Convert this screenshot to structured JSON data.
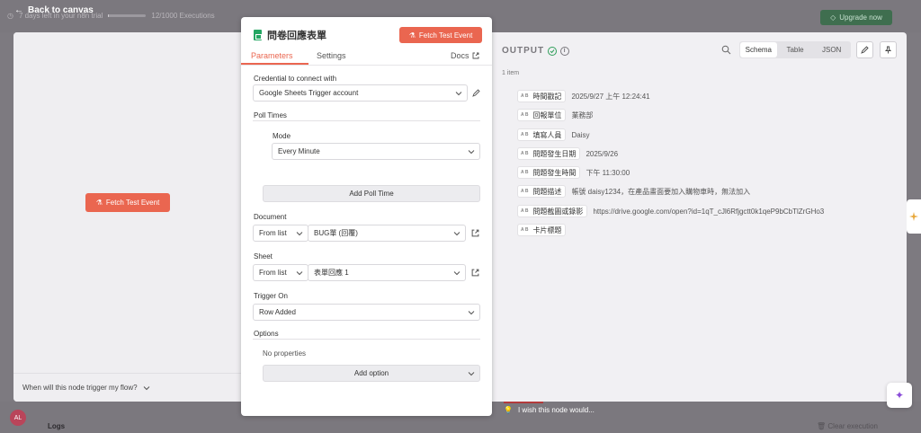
{
  "app": {
    "back_label": "Back to canvas",
    "trial_text": "7 days left in your n8n trial",
    "executions": "12/1000 Executions",
    "executions_fraction": 0.012,
    "upgrade_label": "Upgrade now",
    "logs_label": "Logs",
    "clear_label": "Clear execution",
    "avatar_initials": "AL",
    "brand_color": "#ea6650"
  },
  "input_panel": {
    "fetch_label": "Fetch Test Event",
    "footer_text": "When will this node trigger my flow?"
  },
  "node": {
    "title": "問卷回應表單",
    "icon": "google-sheets-icon",
    "fetch_label": "Fetch Test Event",
    "tabs": {
      "parameters": "Parameters",
      "settings": "Settings",
      "docs": "Docs"
    },
    "credential_label": "Credential to connect with",
    "credential_value": "Google Sheets Trigger account",
    "poll_times_label": "Poll Times",
    "mode_label": "Mode",
    "mode_value": "Every Minute",
    "add_poll_label": "Add Poll Time",
    "document_label": "Document",
    "document_mode": "From list",
    "document_value": "BUG單 (回覆)",
    "sheet_label": "Sheet",
    "sheet_mode": "From list",
    "sheet_value": "表單回應 1",
    "trigger_label": "Trigger On",
    "trigger_value": "Row Added",
    "options_label": "Options",
    "no_properties": "No properties",
    "add_option_label": "Add option"
  },
  "output": {
    "title": "OUTPUT",
    "items_count": "1 item",
    "views": [
      "Schema",
      "Table",
      "JSON"
    ],
    "active_view": "Schema",
    "type_badge": "A B",
    "fields": [
      {
        "name": "時間戳記",
        "value": "2025/9/27 上午 12:24:41"
      },
      {
        "name": "回報單位",
        "value": "業務部"
      },
      {
        "name": "填寫人員",
        "value": "Daisy"
      },
      {
        "name": "問題發生日期",
        "value": "2025/9/26"
      },
      {
        "name": "問題發生時間",
        "value": "下午 11:30:00"
      },
      {
        "name": "問題描述",
        "value": "帳號 daisy1234，在產品畫面要加入購物車時，無法加入"
      },
      {
        "name": "問題截圖或錄影",
        "value": "https://drive.google.com/open?id=1qT_cJl6Rfjgctt0k1qeP9bCbTlZrGHo3"
      },
      {
        "name": "卡片標題",
        "value": ""
      }
    ]
  },
  "feedback": {
    "wish_text": "I wish this node would..."
  }
}
